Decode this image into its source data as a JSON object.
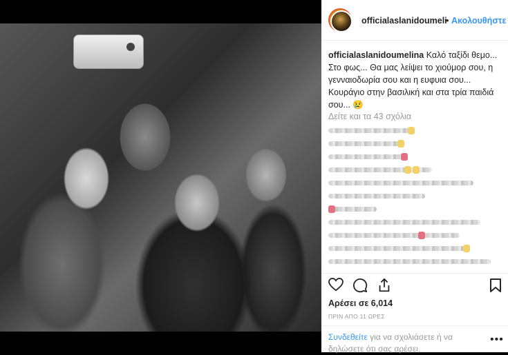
{
  "post": {
    "username": "officialaslanidoumelina",
    "follow_label": "Ακολουθήστε",
    "separator": "•",
    "caption_user": "officialaslanidoumelina",
    "caption_text": "Καλό ταξίδι θεμο... Στο φως... Θα μας λείψει το χιούμορ σου, η γενναιοδωρία σου και η ευφυια σου... Κουράγιο στην βασιλική και στα τρία παιδιά σου... 😢",
    "view_comments": "Δείτε και τα 43 σχόλια",
    "likes": "Αρέσει σε 6,014",
    "time": "ΠΡΙΝ ΑΠΟ 11 ΩΡΕΣ",
    "login_link": "Συνδεθείτε",
    "login_text": " για να σχολιάσετε ή να δηλώσετε ότι σας αρέσει.",
    "more": "•••"
  },
  "icons": {
    "like": "heart-icon",
    "comment": "comment-icon",
    "share": "share-icon",
    "save": "bookmark-icon"
  },
  "colors": {
    "link": "#3897f0",
    "text": "#262626",
    "muted": "#999999"
  }
}
